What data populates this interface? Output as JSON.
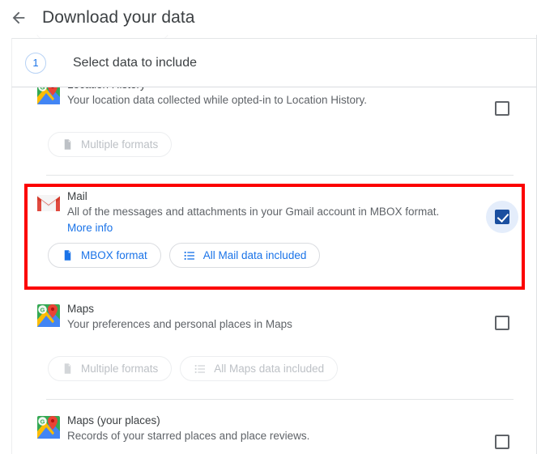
{
  "appbar": {
    "back_icon": "arrow-left-icon",
    "title": "Download your data"
  },
  "step_header": {
    "number": "1",
    "title": "Select data to include"
  },
  "products": [
    {
      "id": "location-history",
      "icon": "google-maps-icon",
      "title": "Location History",
      "description": "Your location data collected while opted-in to Location History.",
      "more_info": null,
      "checked": false,
      "chips": [
        {
          "label": "Multiple formats",
          "icon": "document-icon",
          "state": "disabled"
        }
      ]
    },
    {
      "id": "mail",
      "icon": "gmail-icon",
      "title": "Mail",
      "description": "All of the messages and attachments in your Gmail account in MBOX format.",
      "more_info": "More info",
      "checked": true,
      "chips": [
        {
          "label": "MBOX format",
          "icon": "document-icon",
          "state": "active"
        },
        {
          "label": "All Mail data included",
          "icon": "list-icon",
          "state": "active"
        }
      ]
    },
    {
      "id": "maps",
      "icon": "google-maps-icon",
      "title": "Maps",
      "description": "Your preferences and personal places in Maps",
      "more_info": null,
      "checked": false,
      "chips": [
        {
          "label": "Multiple formats",
          "icon": "document-icon",
          "state": "disabled"
        },
        {
          "label": "All Maps data included",
          "icon": "list-icon",
          "state": "disabled"
        }
      ]
    },
    {
      "id": "maps-your-places",
      "icon": "google-maps-icon",
      "title": "Maps (your places)",
      "description": "Records of your starred places and place reviews.",
      "more_info": null,
      "checked": false,
      "chips": []
    }
  ],
  "annotation": {
    "highlight_color": "#fc0000",
    "highlight_target": "mail"
  },
  "colors": {
    "accent_blue": "#1a73e8",
    "checked_blue": "#1a4fa0",
    "ripple_blue": "#e4edfb",
    "text_primary": "#3c4043",
    "text_secondary": "#5f6368",
    "disabled": "#bdc1c6",
    "divider": "#e3e5e7"
  }
}
